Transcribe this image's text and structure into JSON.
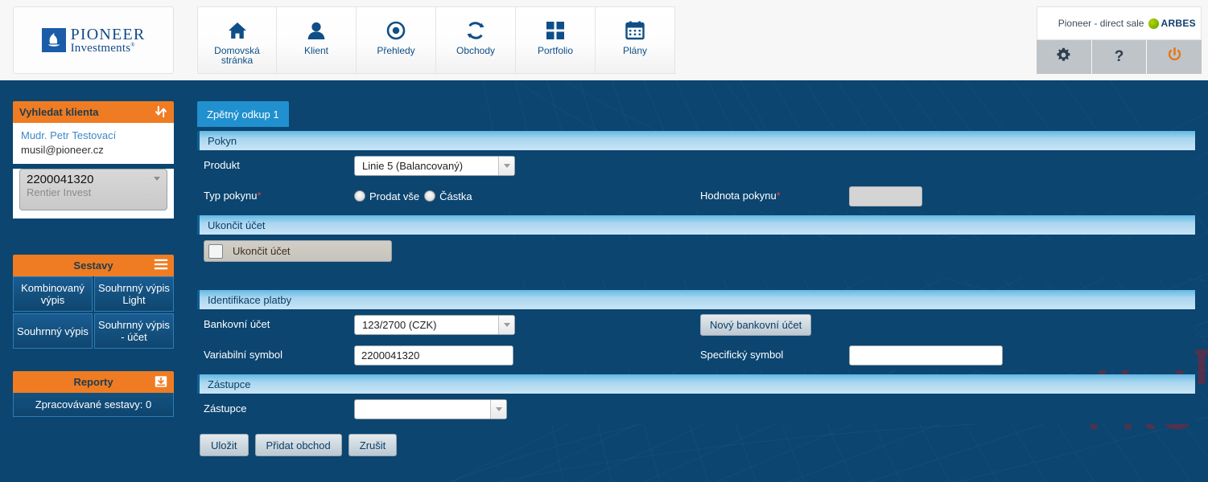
{
  "topbar": {
    "logo": {
      "word1": "PIONEER",
      "word2": "Investments",
      "sup": "®"
    },
    "nav": [
      {
        "label": "Domovská stránka",
        "icon": "home-icon"
      },
      {
        "label": "Klient",
        "icon": "user-icon"
      },
      {
        "label": "Přehledy",
        "icon": "eye-icon"
      },
      {
        "label": "Obchody",
        "icon": "refresh-icon"
      },
      {
        "label": "Portfolio",
        "icon": "grid-icon"
      },
      {
        "label": "Plány",
        "icon": "calendar-icon"
      }
    ],
    "user_label": "Pioneer - direct sale",
    "vendor": "ARBES",
    "buttons": {
      "settings": "gear-icon",
      "help": "?",
      "logout": "power-icon"
    }
  },
  "sidebar": {
    "search_panel": {
      "title": "Vyhledat klienta",
      "icon": "swap-arrows-icon"
    },
    "client": {
      "name": "Mudr. Petr Testovací",
      "email": "musil@pioneer.cz"
    },
    "account": {
      "number": "2200041320",
      "product": "Rentier Invest"
    },
    "sestavy": {
      "title": "Sestavy",
      "icon": "hamburger-icon",
      "buttons": [
        "Kombinovaný výpis",
        "Souhrnný výpis Light",
        "Souhrnný výpis",
        "Souhrnný výpis - účet"
      ]
    },
    "reporty": {
      "title": "Reporty",
      "icon": "inbox-download-icon",
      "status": "Zpracovávané sestavy: 0"
    }
  },
  "main": {
    "tab": "Zpětný odkup 1",
    "watermark": {
      "line1": "TEST",
      "line2": "PRO"
    },
    "sections": {
      "pokyn": {
        "title": "Pokyn",
        "produkt_label": "Produkt",
        "produkt_value": "Linie 5 (Balancovaný)",
        "typ_label": "Typ pokynu",
        "typ_required": "*",
        "radios": [
          {
            "label": "Prodat vše",
            "selected": false
          },
          {
            "label": "Částka",
            "selected": false
          }
        ],
        "hodnota_label": "Hodnota pokynu",
        "hodnota_required": "*",
        "hodnota_value": ""
      },
      "ukoncit": {
        "title": "Ukončit účet",
        "checkbox_label": "Ukončit účet",
        "checked": false
      },
      "platba": {
        "title": "Identifikace platby",
        "ucet_label": "Bankovní účet",
        "ucet_value": "123/2700 (CZK)",
        "novy_ucet_button": "Nový bankovní účet",
        "vs_label": "Variabilní symbol",
        "vs_value": "2200041320",
        "ss_label": "Specifický symbol",
        "ss_value": ""
      },
      "zastupce": {
        "title": "Zástupce",
        "label": "Zástupce",
        "value": ""
      }
    },
    "footer_buttons": [
      "Uložit",
      "Přidat obchod",
      "Zrušit"
    ]
  },
  "colors": {
    "page_bg": "#0b4570",
    "accent_orange": "#ef7c22",
    "tab_blue": "#2090cf",
    "section_header": "#a9d6ef",
    "required_red": "#e8453c",
    "watermark_red": "#8c2230",
    "brand_blue": "#0f4e87"
  }
}
